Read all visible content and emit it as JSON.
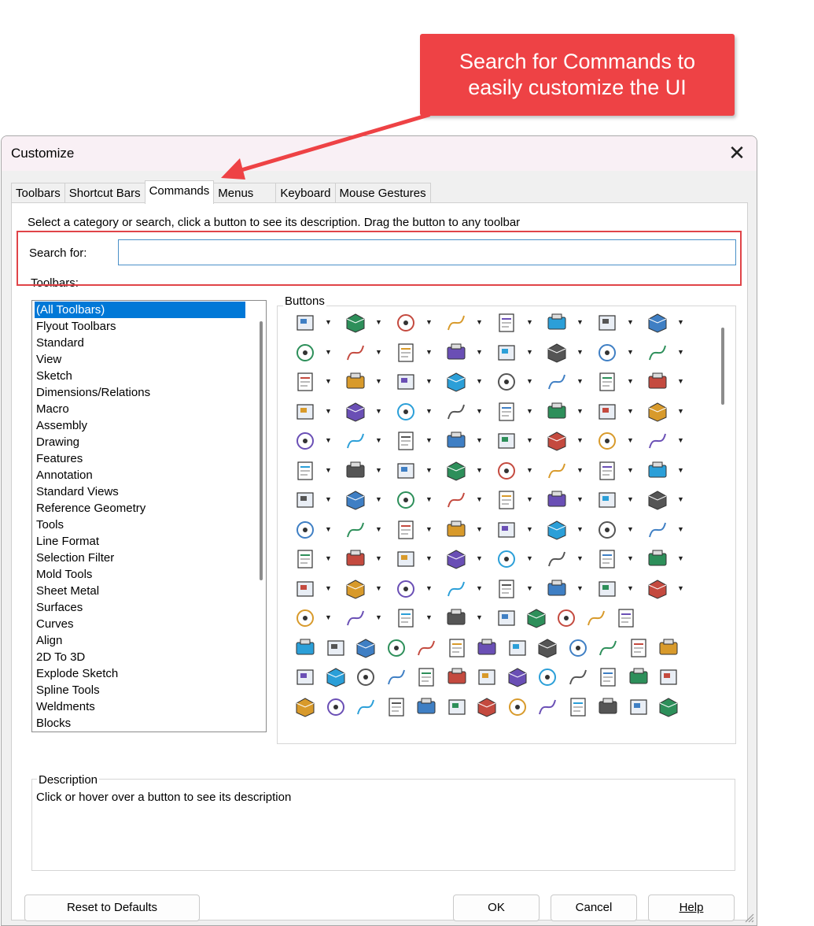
{
  "callout": {
    "line1": "Search for Commands to",
    "line2": "easily customize the UI",
    "color": "#ee4245"
  },
  "dialog": {
    "title": "Customize",
    "tabs": [
      "Toolbars",
      "Shortcut Bars",
      "Commands",
      "Menus",
      "Keyboard",
      "Mouse Gestures"
    ],
    "active_tab": "Commands",
    "instruction": "Select a category or search, click a button to see its description. Drag the button to any toolbar",
    "search": {
      "label": "Search for:",
      "value": ""
    },
    "toolbars_label": "Toolbars:",
    "toolbars": [
      "(All Toolbars)",
      "Flyout Toolbars",
      "Standard",
      "View",
      "Sketch",
      "Dimensions/Relations",
      "Macro",
      "Assembly",
      "Drawing",
      "Features",
      "Annotation",
      "Standard Views",
      "Reference Geometry",
      "Tools",
      "Line Format",
      "Selection Filter",
      "Mold Tools",
      "Sheet Metal",
      "Surfaces",
      "Curves",
      "Align",
      "2D To 3D",
      "Explode Sketch",
      "Spline Tools",
      "Weldments",
      "Blocks"
    ],
    "selected_toolbar": "(All Toolbars)",
    "buttons_label": "Buttons",
    "description": {
      "label": "Description",
      "text": "Click or hover over a button to see its description"
    },
    "footer": {
      "reset": "Reset to Defaults",
      "ok": "OK",
      "cancel": "Cancel",
      "help": "Help"
    },
    "accent_color": "#0078d7"
  }
}
